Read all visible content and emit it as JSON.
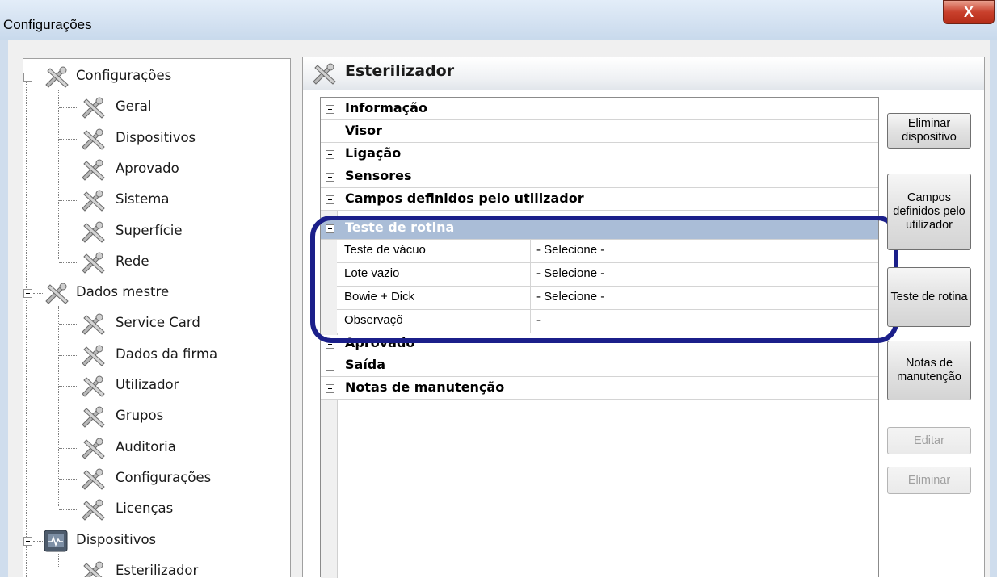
{
  "window": {
    "title": "Configurações",
    "close_label": "X"
  },
  "tree": {
    "items": [
      {
        "label": "Configurações",
        "level": 0,
        "icon": "tools-icon"
      },
      {
        "label": "Geral",
        "level": 1,
        "icon": "tools-icon"
      },
      {
        "label": "Dispositivos",
        "level": 1,
        "icon": "tools-icon"
      },
      {
        "label": "Aprovado",
        "level": 1,
        "icon": "tools-icon"
      },
      {
        "label": "Sistema",
        "level": 1,
        "icon": "tools-icon"
      },
      {
        "label": "Superfície",
        "level": 1,
        "icon": "tools-icon"
      },
      {
        "label": "Rede",
        "level": 1,
        "icon": "tools-icon"
      },
      {
        "label": "Dados mestre",
        "level": 0,
        "icon": "tools-icon"
      },
      {
        "label": "Service Card",
        "level": 1,
        "icon": "tools-icon"
      },
      {
        "label": "Dados da firma",
        "level": 1,
        "icon": "tools-icon"
      },
      {
        "label": "Utilizador",
        "level": 1,
        "icon": "tools-icon"
      },
      {
        "label": "Grupos",
        "level": 1,
        "icon": "tools-icon"
      },
      {
        "label": "Auditoria",
        "level": 1,
        "icon": "tools-icon"
      },
      {
        "label": "Configurações",
        "level": 1,
        "icon": "tools-icon"
      },
      {
        "label": "Licenças",
        "level": 1,
        "icon": "tools-icon"
      },
      {
        "label": "Dispositivos",
        "level": 0,
        "icon": "monitor-icon"
      },
      {
        "label": "Esterilizador",
        "level": 1,
        "icon": "tools-icon"
      }
    ]
  },
  "panel": {
    "title": "Esterilizador",
    "categories": [
      "Informação",
      "Visor",
      "Ligação",
      "Sensores",
      "Campos definidos pelo utilizador",
      "Teste de rotina",
      "Aprovado",
      "Saída",
      "Notas de manutenção"
    ],
    "expanded_properties": [
      {
        "name": "Teste de vácuo",
        "value": "- Selecione -"
      },
      {
        "name": "Lote vazio",
        "value": "- Selecione -"
      },
      {
        "name": "Bowie + Dick",
        "value": "- Selecione -"
      },
      {
        "name": "Observaçõ",
        "value": "-"
      }
    ]
  },
  "buttons": {
    "delete_device": "Eliminar dispositivo",
    "user_fields": "Campos definidos pelo utilizador",
    "routine_test": "Teste de rotina",
    "maintenance_notes": "Notas de manutenção",
    "edit": "Editar",
    "delete": "Eliminar"
  },
  "colors": {
    "selection_header": "#aabdd7",
    "highlight_ring": "#1b1f8a",
    "close_button": "#c9402c"
  }
}
